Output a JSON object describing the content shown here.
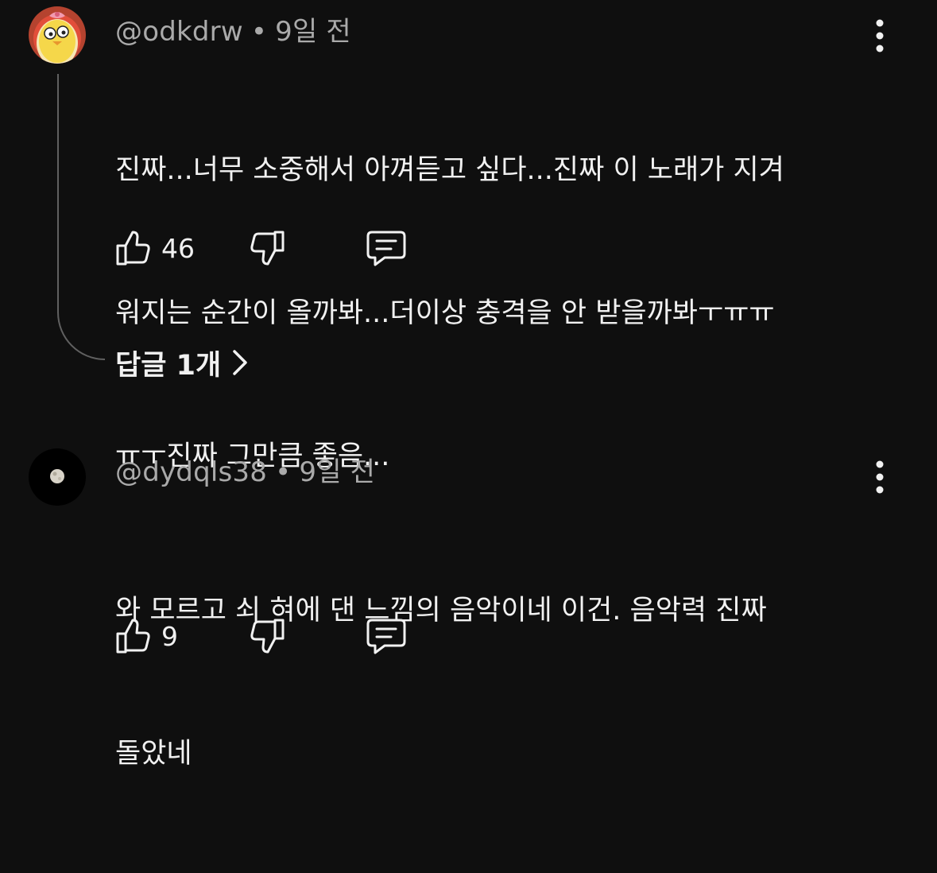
{
  "comments": [
    {
      "handle": "@odkdrw",
      "time": "9일 전",
      "lines": [
        "진짜...너무 소중해서 아껴듣고 싶다...진짜 이 노래가 지겨",
        "워지는 순간이 올까봐...더이상 충격을 안 받을까봐ㅜㅠㅠ",
        "ㅠㅜ진짜 그만큼 좋음..."
      ],
      "likes": "46",
      "replies_label": "답글 1개",
      "avatar_icon": "cartoon-bird-avatar"
    },
    {
      "handle": "@dydqls38",
      "time": "9일 전",
      "lines": [
        "와 모르고 쇠 혀에 댄 느낌의 음악이네 이건. 음악력 진짜",
        "돌았네"
      ],
      "likes": "9",
      "avatar_icon": "moon-avatar"
    }
  ],
  "separator": "•",
  "icons": {
    "like": "thumbs-up-icon",
    "dislike": "thumbs-down-icon",
    "reply": "comment-icon",
    "more": "more-vert-icon",
    "chevron": "chevron-right-icon"
  },
  "colors": {
    "background": "#0f0f0f",
    "text": "#f1f1f1",
    "secondary": "#aaaaaa",
    "thread_line": "#606060"
  }
}
